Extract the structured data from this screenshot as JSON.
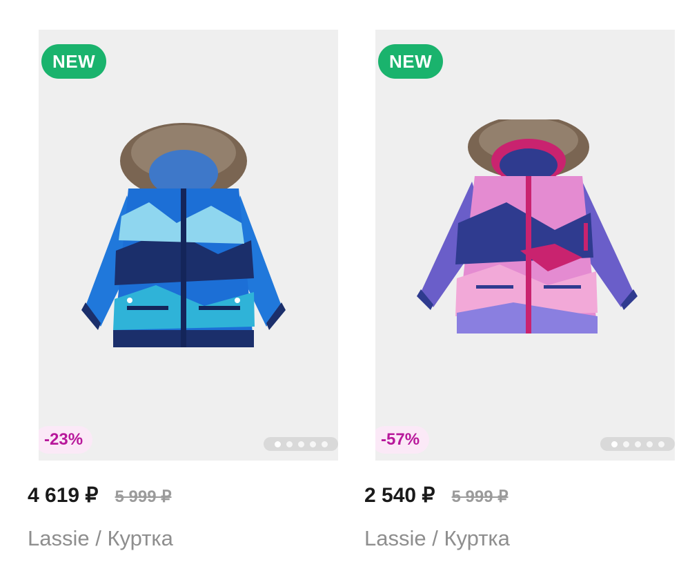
{
  "products": [
    {
      "badge": "NEW",
      "discount": "-23%",
      "price": "4 619 ₽",
      "old_price": "5 999 ₽",
      "title": "Lassie / Куртка",
      "image_count": 5,
      "active_image": 1,
      "colors": {
        "primary": "#1c6fd6",
        "secondary": "#1b2f6b",
        "accent": "#2fb3d8"
      }
    },
    {
      "badge": "NEW",
      "discount": "-57%",
      "price": "2 540 ₽",
      "old_price": "5 999 ₽",
      "title": "Lassie / Куртка",
      "image_count": 5,
      "active_image": 1,
      "colors": {
        "primary": "#e48bd1",
        "secondary": "#2f3b8f",
        "accent": "#c9236f"
      }
    }
  ],
  "colors": {
    "badge_new_bg": "#1ab36d",
    "discount_text": "#b8189b",
    "discount_bg": "#fbe9f7",
    "card_bg": "#efefef"
  }
}
